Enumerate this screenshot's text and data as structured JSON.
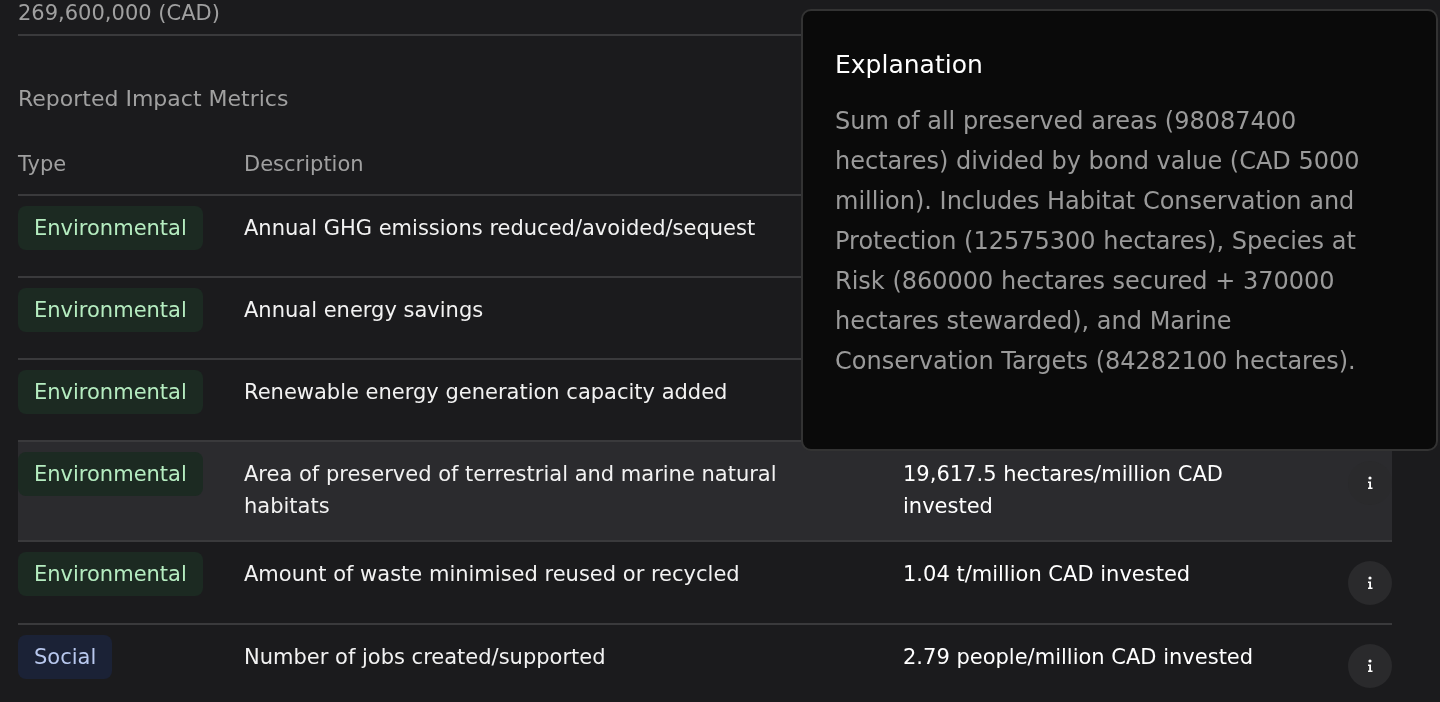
{
  "summary_value": "269,600,000 (CAD)",
  "section_title": "Reported Impact Metrics",
  "table": {
    "columns": [
      "Type",
      "Description"
    ],
    "rows": [
      {
        "type": "Environmental",
        "kind": "environmental",
        "description": "Annual GHG emissions reduced/avoided/sequest",
        "selected": false
      },
      {
        "type": "Environmental",
        "kind": "environmental",
        "description": "Annual energy savings",
        "selected": false
      },
      {
        "type": "Environmental",
        "kind": "environmental",
        "description": "Renewable energy generation capacity added",
        "selected": false
      },
      {
        "type": "Environmental",
        "kind": "environmental",
        "description": "Area of preserved of terrestrial and marine natural habitats",
        "value": "19,617.5 hectares/million CAD invested",
        "selected": true
      },
      {
        "type": "Environmental",
        "kind": "environmental",
        "description": "Amount of waste minimised reused or recycled",
        "value": "1.04 t/million CAD invested",
        "selected": false
      },
      {
        "type": "Social",
        "kind": "social",
        "description": "Number of jobs created/supported",
        "value": "2.79 people/million CAD invested",
        "selected": false
      }
    ]
  },
  "tooltip": {
    "title": "Explanation",
    "text": "Sum of all preserved areas (98087400 hectares) divided by bond value (CAD 5000 million). Includes Habitat Conservation and Protection (12575300 hectares), Species at Risk (860000 hectares secured + 370000 hectares stewarded), and Marine Conservation Targets (84282100 hectares)."
  }
}
